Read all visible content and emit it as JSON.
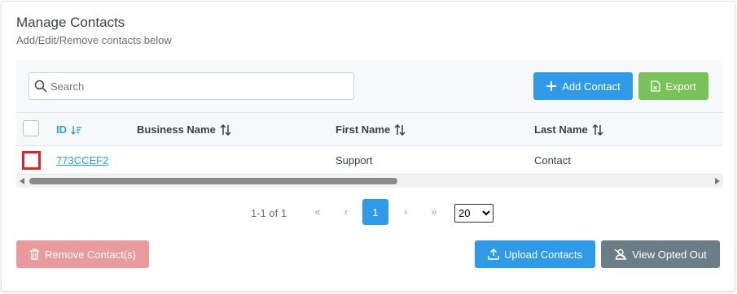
{
  "header": {
    "title": "Manage Contacts",
    "subtitle": "Add/Edit/Remove contacts below"
  },
  "search": {
    "placeholder": "Search",
    "value": ""
  },
  "toolbar": {
    "add_label": "Add Contact",
    "export_label": "Export"
  },
  "table": {
    "columns": [
      {
        "label": "ID",
        "sort": "active-desc"
      },
      {
        "label": "Business Name",
        "sort": "none"
      },
      {
        "label": "First Name",
        "sort": "none"
      },
      {
        "label": "Last Name",
        "sort": "none"
      }
    ],
    "rows": [
      {
        "id": "773CCEF2",
        "business_name": "",
        "first_name": "Support",
        "last_name": "Contact"
      }
    ]
  },
  "pagination": {
    "info": "1-1 of 1",
    "current_page": "1",
    "first_label": "«",
    "prev_label": "‹",
    "next_label": "›",
    "last_label": "»",
    "page_size": "20",
    "page_size_options": [
      "20"
    ]
  },
  "footer": {
    "remove_label": "Remove Contact(s)",
    "upload_label": "Upload Contacts",
    "opted_out_label": "View Opted Out"
  },
  "colors": {
    "primary": "#2f9be8",
    "success": "#79c25a",
    "danger_disabled": "#e89a9c",
    "secondary": "#6a7d88",
    "highlight": "#d9262a"
  },
  "icons": {
    "search": "search-icon",
    "add": "plus-icon",
    "export": "file-spreadsheet-icon",
    "sort": "sort-arrows-icon",
    "remove": "trash-icon",
    "upload": "upload-icon",
    "opted_out": "user-slash-icon"
  }
}
